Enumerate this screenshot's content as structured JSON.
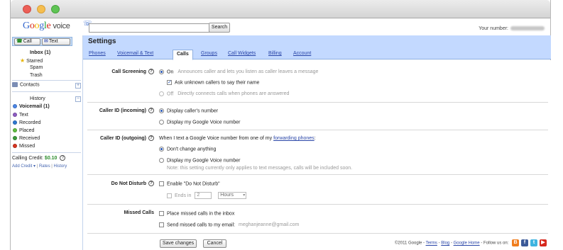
{
  "window": {
    "traffic_lights": [
      "#ec5f57",
      "#f5be4f",
      "#5fc454"
    ]
  },
  "topbar": {
    "logo": {
      "g": "G",
      "o1": "o",
      "o2": "o",
      "g2": "g",
      "l": "l",
      "e": "e",
      "suffix": "voice"
    },
    "search_placeholder": "",
    "search_button": "Search",
    "your_number_label": "Your number:"
  },
  "sidebar": {
    "call_button": "Call",
    "text_button": "Text",
    "inbox": "Inbox (1)",
    "starred": "Starred",
    "spam": "Spam",
    "trash": "Trash",
    "contacts": "Contacts",
    "history": "History",
    "history_items": [
      {
        "label": "Voicemail (1)",
        "color": "#4a86e8"
      },
      {
        "label": "Text",
        "color": "#8e5cc4"
      },
      {
        "label": "Recorded",
        "color": "#2e78d2"
      },
      {
        "label": "Placed",
        "color": "#5fbf3f"
      },
      {
        "label": "Received",
        "color": "#3b9b3b"
      },
      {
        "label": "Missed",
        "color": "#d8331f"
      }
    ],
    "calling_credit_label": "Calling Credit:",
    "calling_credit_amount": "$0.10",
    "add_credit": "Add Credit ▾",
    "rates": "Rates",
    "history_link": "History"
  },
  "main": {
    "title": "Settings",
    "tabs": [
      "Phones",
      "Voicemail & Text",
      "Calls",
      "Groups",
      "Call Widgets",
      "Billing",
      "Account"
    ],
    "active_tab": "Calls",
    "call_screening": {
      "label": "Call Screening",
      "on": "On",
      "on_hint": "Announces caller and lets you listen as caller leaves a message",
      "ask_name": "Ask unknown callers to say their name",
      "off": "Off",
      "off_hint": "Directly connects calls when phones are answered"
    },
    "caller_id_incoming": {
      "label": "Caller ID (incoming)",
      "opt1": "Display caller's number",
      "opt2": "Display my Google Voice number"
    },
    "caller_id_outgoing": {
      "label": "Caller ID (outgoing)",
      "intro": "When I text a Google Voice number from one of my",
      "intro_link": "forwarding phones",
      "intro_end": ":",
      "opt1": "Don't change anything",
      "opt2": "Display my Google Voice number",
      "note": "Note: this setting currently only applies to text messages, calls will be included soon."
    },
    "do_not_disturb": {
      "label": "Do Not Disturb",
      "enable": "Enable \"Do Not Disturb\"",
      "ends_in": "Ends in",
      "ends_value": "2",
      "unit": "Hours"
    },
    "missed_calls": {
      "label": "Missed Calls",
      "opt1": "Place missed calls in the inbox",
      "opt2": "Send missed calls to my email:",
      "email": "meghanjeanne@gmail.com"
    },
    "save_button": "Save changes",
    "cancel_button": "Cancel",
    "footer": {
      "copyright": "©2011 Google -",
      "terms": "Terms",
      "blog": "Blog",
      "home": "Google Home",
      "follow": "- Follow us on:",
      "dash": "-"
    }
  }
}
